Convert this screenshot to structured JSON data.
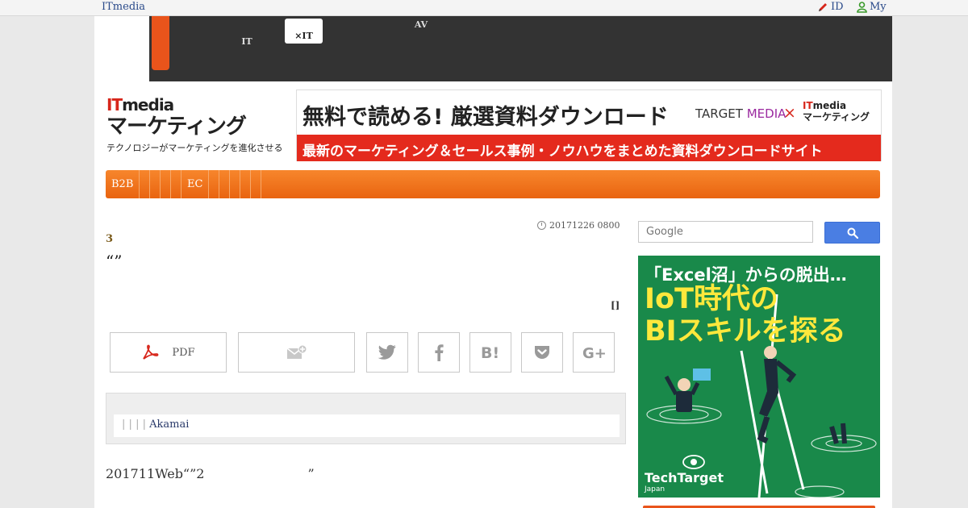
{
  "topbar": {
    "brand": "ITmedia",
    "id_label": "ID",
    "my_label": "My"
  },
  "darknav": {
    "items": [
      {
        "label": "　　\nIT"
      },
      {
        "label": "　　\n×IT"
      },
      {
        "label": "AV\n　　"
      }
    ]
  },
  "header": {
    "logo_line1_it": "IT",
    "logo_line1_rest": "media",
    "logo_line2": "マーケティング",
    "logo_tagline": "テクノロジーがマーケティングを進化させる",
    "banner_title": "無料で読める! 厳選資料ダウンロード",
    "banner_partner": "TARGET",
    "banner_partner_media": "MEDIA",
    "banner_cross": "×",
    "banner_mk_it": "IT",
    "banner_mk_rest": "media",
    "banner_mk_line2": "マーケティング",
    "banner_sub": "最新のマーケティング＆セールス事例・ノウハウをまとめた資料ダウンロードサイト"
  },
  "menu": {
    "items": [
      "B2B",
      "",
      "",
      "",
      "",
      "EC",
      "",
      "",
      "",
      "",
      ""
    ]
  },
  "article": {
    "date": "20171226 0800",
    "kicker": "3",
    "headline": "“”",
    "brackets": "[]",
    "pdf_label": "PDF",
    "related_links": [
      "",
      "",
      "",
      "Akamai"
    ],
    "body": "201711Web“”2　　　　　　　　”"
  },
  "search": {
    "placeholder": "Google"
  },
  "ad": {
    "line1": "「Excel沼」からの脱出…",
    "line2": "IoT時代の",
    "line3": "BIスキルを探る",
    "logo_name": "TechTarget",
    "logo_sub": "Japan"
  },
  "colors": {
    "accent": "#e9541b",
    "search_blue": "#4a7ee3",
    "ad_green": "#19894a"
  }
}
